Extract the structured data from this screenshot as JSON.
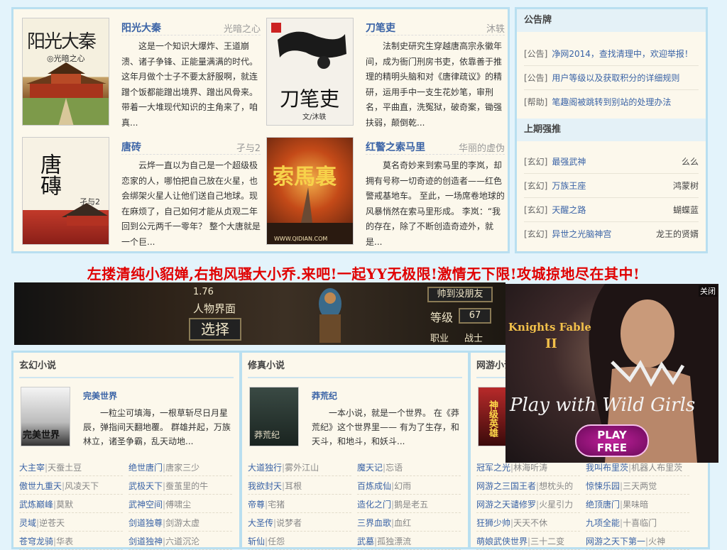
{
  "featured": [
    {
      "title": "阳光大秦",
      "author": "光暗之心",
      "desc": "这是一个知识大爆炸、王道崩溃、诸子争锋、正能量满满的时代。 这年月做个士子不要太舒服啊，就连蹭个饭都能蹭出境界、蹭出风骨来。 带着一大堆现代知识的主角来了，咱真...",
      "cover_text": "阳光大秦",
      "cover_sub": "◎光暗之心"
    },
    {
      "title": "刀笔吏",
      "author": "沐轶",
      "desc": "法制史研究生穿越唐高宗永徽年间，成为衙门刑房书吏，依靠善于推理的精明头脑和对《唐律疏议》的精研，运用手中一支生花妙笔，审刑名，平曲直，洗冤狱，破奇案，锄强扶弱，颠倒乾...",
      "cover_text": "刀笔吏",
      "cover_sub": "文/沐轶"
    },
    {
      "title": "唐砖",
      "author": "孑与2",
      "desc": "云烨一直以为自己是一个超级极恋家的人，哪怕把自己放在火星，也会绑架火星人让他们送自己地球。现在麻烦了，自己如何才能从贞观二年回到公元两千一零年？ 整个大唐就是一个巨...",
      "cover_text": "唐磚",
      "cover_sub": "孑与2"
    },
    {
      "title": "红警之索马里",
      "author": "华丽的虚伪",
      "desc": "莫名奇妙来到索马里的李岚，却拥有号称一切奇迹的创造者——红色警戒基地车。 至此，一场席卷地球的风暴悄然在索马里形成。 李岚：“我的存在，除了不断创造奇迹外，就是...",
      "cover_text": "索馬裏",
      "cover_sub": "WWW.QIDIAN.COM"
    }
  ],
  "notice": {
    "heading": "公告牌",
    "items": [
      {
        "cat": "[公告]",
        "text": "净网2014，查找清理中，欢迎举报！"
      },
      {
        "cat": "[公告]",
        "text": "用户等级以及获取积分的详细规则"
      },
      {
        "cat": "[帮助]",
        "text": "笔趣阁被跳转到别站的处理办法"
      }
    ]
  },
  "last_week": {
    "heading": "上期强推",
    "items": [
      {
        "cat": "[玄幻]",
        "title": "最强武神",
        "author": "么么"
      },
      {
        "cat": "[玄幻]",
        "title": "万族王座",
        "author": "鸿蒙树"
      },
      {
        "cat": "[玄幻]",
        "title": "天醒之路",
        "author": "蝴蝶蓝"
      },
      {
        "cat": "[玄幻]",
        "title": "异世之光脑神宫",
        "author": "龙王的贤婿"
      }
    ]
  },
  "slogan": "左搂清纯小貂婵,右抱风骚大小乔.来吧!一起YY无极限!激情无下限!攻城掠地尽在其中!",
  "game_banner": {
    "version": "1.76",
    "char_screen": "人物界面",
    "select": "选择",
    "friend": "帅到没朋友",
    "level_label": "等级",
    "level_value": "67",
    "job_label": "职业",
    "job_value": "战士"
  },
  "ad": {
    "close": "关闭",
    "logo": "Knights Fable",
    "logo_num": "II",
    "tagline": "Play with Wild Girls",
    "cta_line1": "PLAY",
    "cta_line2": "FREE"
  },
  "categories": [
    {
      "title": "玄幻小说",
      "book": {
        "name": "完美世界",
        "desc": "一粒尘可填海，一根草斩尽日月星辰，弹指间天翻地覆。 群雄并起，万族林立，诸圣争霸，乱天动地...",
        "cover_text": "完美世界"
      },
      "list": [
        {
          "n": "大主宰",
          "a": "天蚕土豆"
        },
        {
          "n": "绝世唐门",
          "a": "唐家三少"
        },
        {
          "n": "傲世九重天",
          "a": "风凌天下"
        },
        {
          "n": "武极天下",
          "a": "蚕茧里的牛"
        },
        {
          "n": "武炼巅峰",
          "a": "莫默"
        },
        {
          "n": "武神空间",
          "a": "傅啸尘"
        },
        {
          "n": "灵域",
          "a": "逆苍天"
        },
        {
          "n": "剑道独尊",
          "a": "剑游太虚"
        },
        {
          "n": "苍穹龙骑",
          "a": "华表"
        },
        {
          "n": "剑道独神",
          "a": "六道沉沦"
        }
      ]
    },
    {
      "title": "修真小说",
      "book": {
        "name": "莽荒纪",
        "desc": "一本小说，就是一个世界。 在《莽荒纪》这个世界里—— 有为了生存，和天斗，和地斗，和妖斗...",
        "cover_text": "莽荒纪"
      },
      "list": [
        {
          "n": "大道独行",
          "a": "雾外江山"
        },
        {
          "n": "魔天记",
          "a": "忘语"
        },
        {
          "n": "我欲封天",
          "a": "耳根"
        },
        {
          "n": "百炼成仙",
          "a": "幻雨"
        },
        {
          "n": "帝尊",
          "a": "宅猪"
        },
        {
          "n": "造化之门",
          "a": "鹅是老五"
        },
        {
          "n": "大圣传",
          "a": "说梦者"
        },
        {
          "n": "三界血歌",
          "a": "血红"
        },
        {
          "n": "斩仙",
          "a": "任怨"
        },
        {
          "n": "武墓",
          "a": "孤独漂流"
        }
      ]
    },
    {
      "title": "网游小说",
      "book": {
        "name": "",
        "desc": "",
        "cover_text": "神级英雄"
      },
      "list": [
        {
          "n": "冠军之光",
          "a": "林海听涛"
        },
        {
          "n": "我叫布里茨",
          "a": "机器人布里茨"
        },
        {
          "n": "网游之三国王者",
          "a": "想枕头的"
        },
        {
          "n": "惊悚乐园",
          "a": "三天两觉"
        },
        {
          "n": "网游之天谴修罗",
          "a": "火星引力"
        },
        {
          "n": "绝顶唐门",
          "a": "果味暗"
        },
        {
          "n": "狂狮少帅",
          "a": "天天不休"
        },
        {
          "n": "九项全能",
          "a": "十喜临门"
        },
        {
          "n": "萌娘武侠世界",
          "a": "三十二变"
        },
        {
          "n": "网游之天下第一",
          "a": "火神"
        }
      ]
    }
  ],
  "colors": {
    "panel_bg": "#fcf8ec",
    "border": "#b9dff0",
    "link": "#3a63a6",
    "slogan": "#e00000"
  }
}
